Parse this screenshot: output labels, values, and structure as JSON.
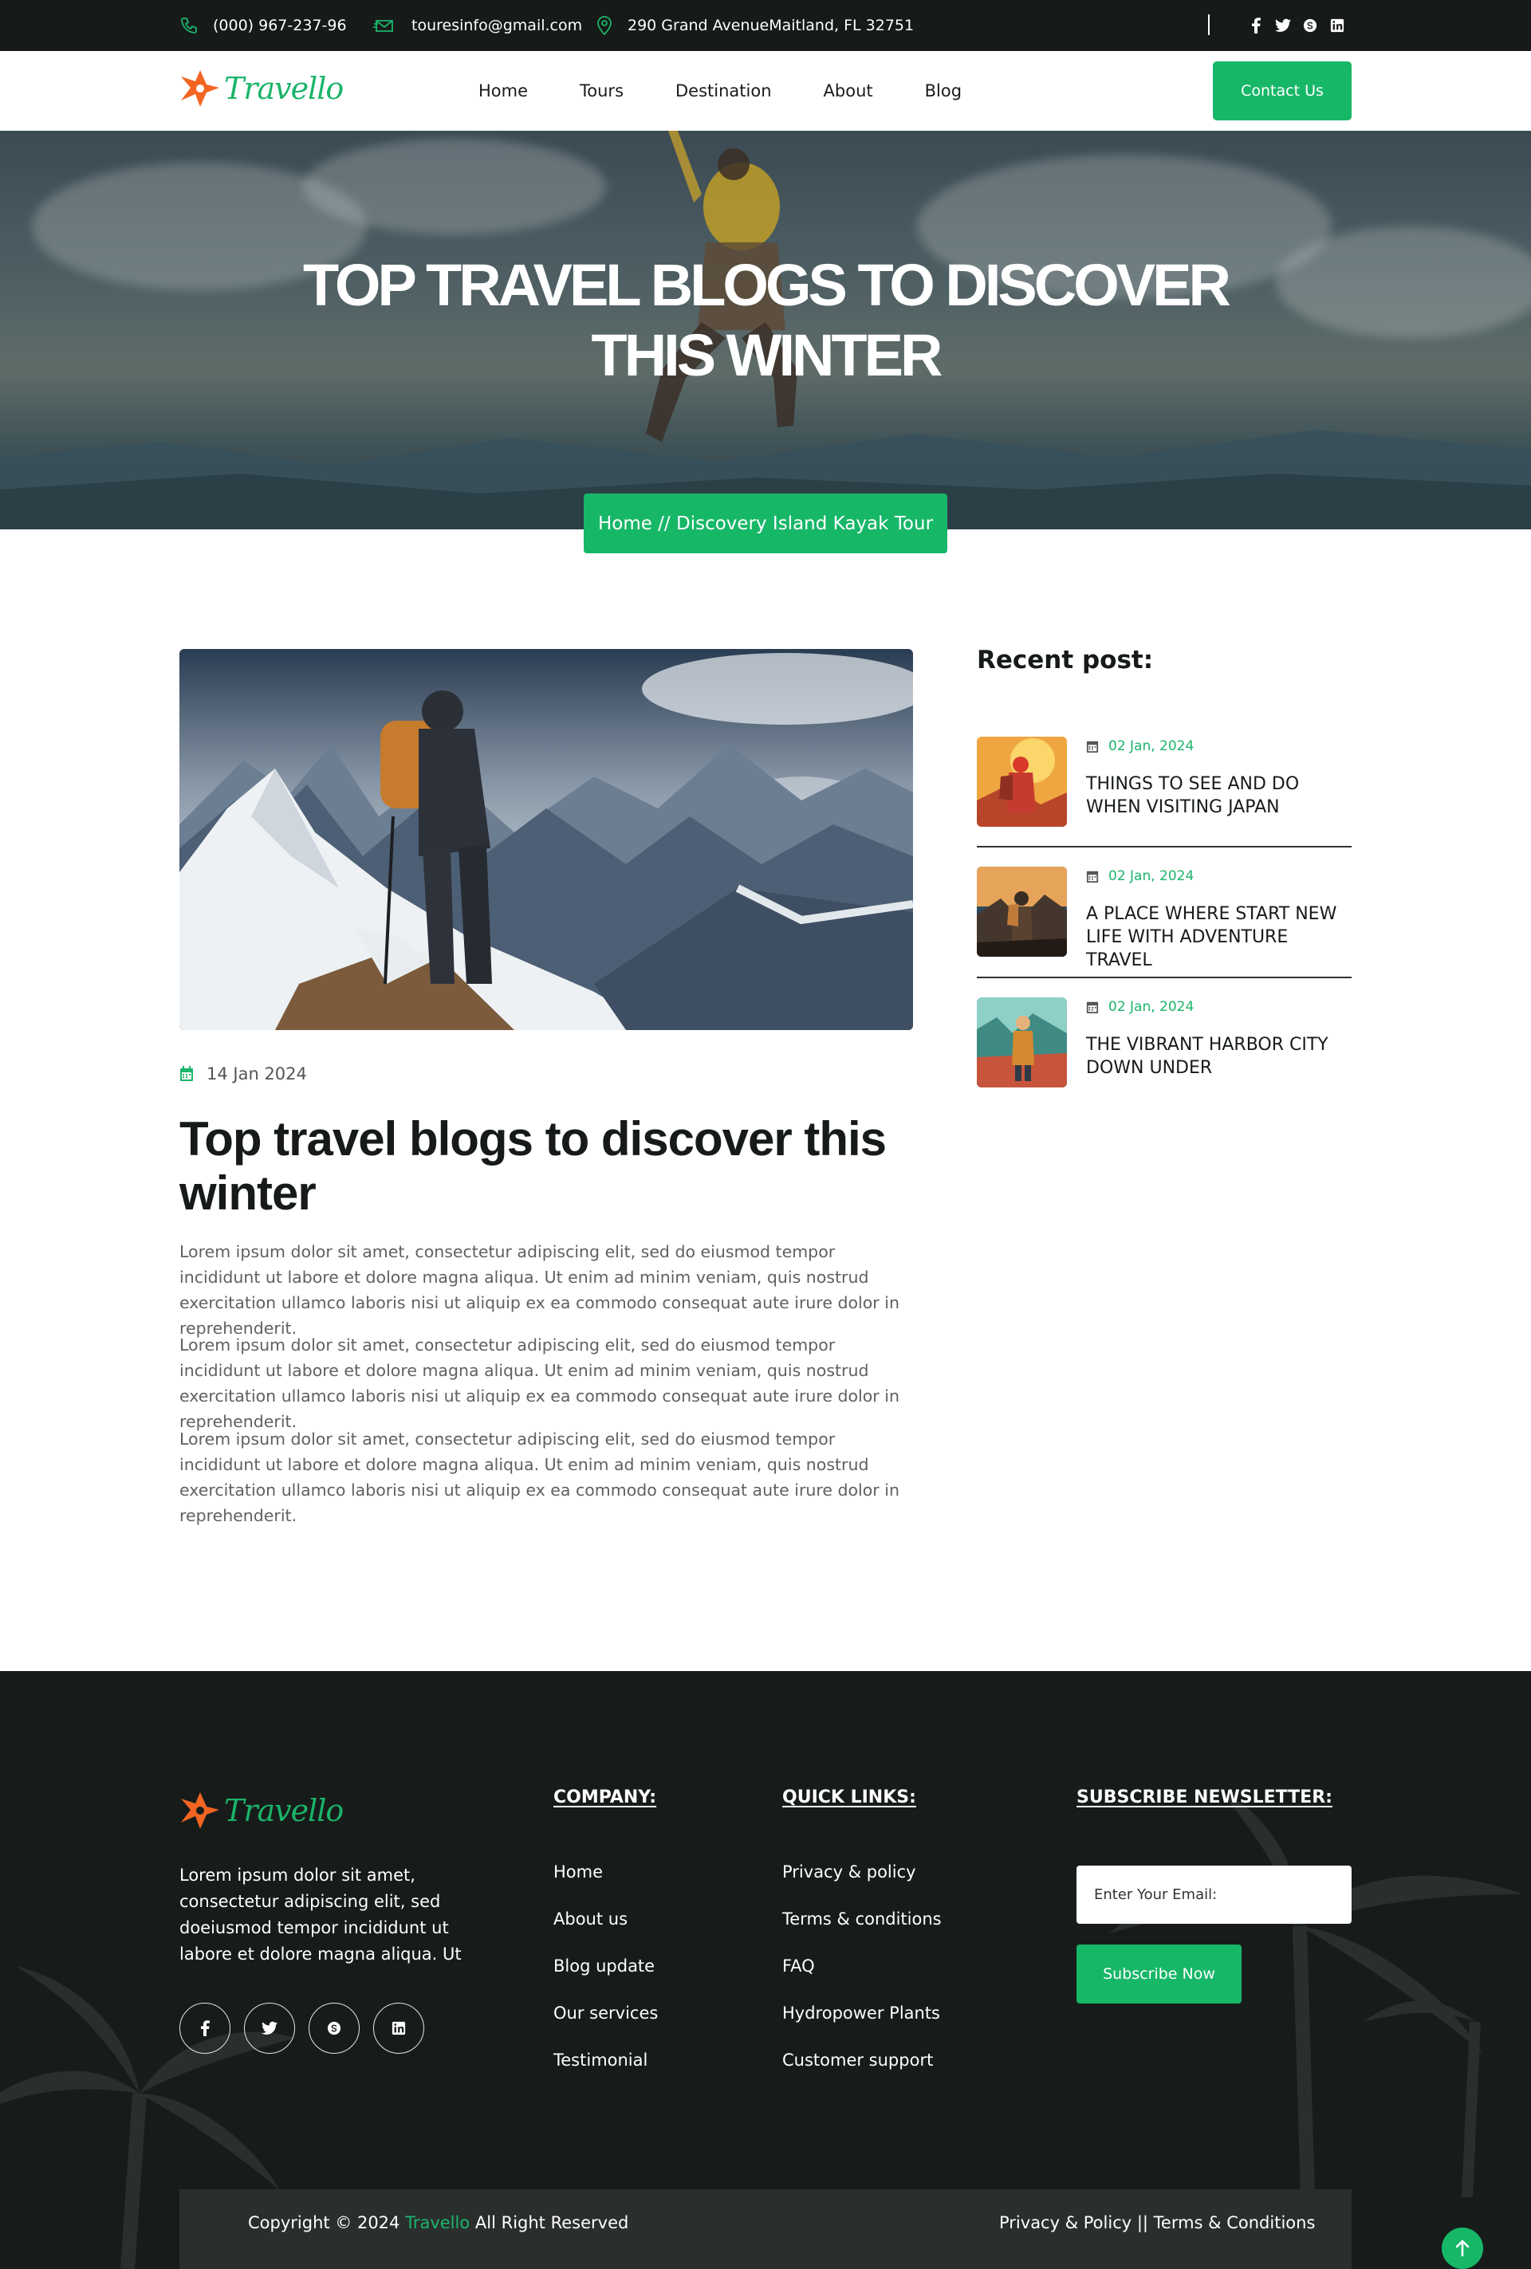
{
  "topbar": {
    "phone": "(000) 967-237-96",
    "email": "touresinfo@gmail.com",
    "address": "290 Grand AvenueMaitland, FL 32751",
    "social_icons": [
      "facebook-icon",
      "twitter-icon",
      "skype-icon",
      "linkedin-icon"
    ]
  },
  "nav": {
    "logo_text": "Travello",
    "items": [
      "Home",
      "Tours",
      "Destination",
      "About",
      "Blog"
    ],
    "contact_label": "Contact Us"
  },
  "hero": {
    "title_line1": "TOP TRAVEL BLOGS TO DISCOVER",
    "title_line2": "THIS WINTER",
    "breadcrumb": "Home // Discovery Island Kayak Tour"
  },
  "post": {
    "date": "14 Jan 2024",
    "title": "Top travel blogs to discover this winter",
    "paragraphs": [
      "Lorem ipsum dolor sit amet, consectetur adipiscing elit, sed do eiusmod tempor incididunt ut labore et dolore magna aliqua. Ut enim ad minim veniam, quis nostrud exercitation ullamco laboris nisi ut aliquip ex ea commodo consequat aute irure dolor in reprehenderit.",
      "Lorem ipsum dolor sit amet, consectetur adipiscing elit, sed do eiusmod tempor incididunt ut labore et dolore magna aliqua. Ut enim ad minim veniam, quis nostrud exercitation ullamco laboris nisi ut aliquip ex ea commodo consequat aute irure dolor in reprehenderit.",
      "Lorem ipsum dolor sit amet, consectetur adipiscing elit, sed do eiusmod tempor incididunt ut labore et dolore magna aliqua. Ut enim ad minim veniam, quis nostrud exercitation ullamco laboris nisi ut aliquip ex ea commodo consequat aute irure dolor in reprehenderit."
    ]
  },
  "sidebar": {
    "title": "Recent post:",
    "posts": [
      {
        "date": "02 Jan, 2024",
        "title": "THINGS TO SEE AND DO WHEN VISITING JAPAN"
      },
      {
        "date": "02 Jan, 2024",
        "title": "A PLACE WHERE START NEW LIFE WITH ADVENTURE TRAVEL"
      },
      {
        "date": "02 Jan, 2024",
        "title": "THE VIBRANT HARBOR CITY DOWN UNDER"
      }
    ]
  },
  "footer": {
    "logo_text": "Travello",
    "description": "Lorem ipsum dolor sit amet, consectetur adipiscing elit, sed doeiusmod tempor incididunt ut labore et dolore magna aliqua. Ut",
    "company_heading": "COMPANY:",
    "company_links": [
      "Home",
      "About us",
      "Blog update",
      "Our services",
      "Testimonial"
    ],
    "quick_heading": "QUICK LINKS:",
    "quick_links": [
      "Privacy & policy",
      "Terms & conditions",
      "FAQ",
      "Hydropower Plants",
      "Customer support"
    ],
    "newsletter_heading": "SUBSCRIBE NEWSLETTER:",
    "email_placeholder": "Enter Your Email:",
    "subscribe_label": "Subscribe Now",
    "copyright_prefix": "Copyright © 2024",
    "copyright_brand": "Travello",
    "copyright_suffix": "All Right Reserved",
    "bottom_links": "Privacy & Policy || Terms & Conditions"
  },
  "colors": {
    "accent": "#17b768",
    "dark": "#161b19",
    "logo_orange": "#f26522"
  }
}
